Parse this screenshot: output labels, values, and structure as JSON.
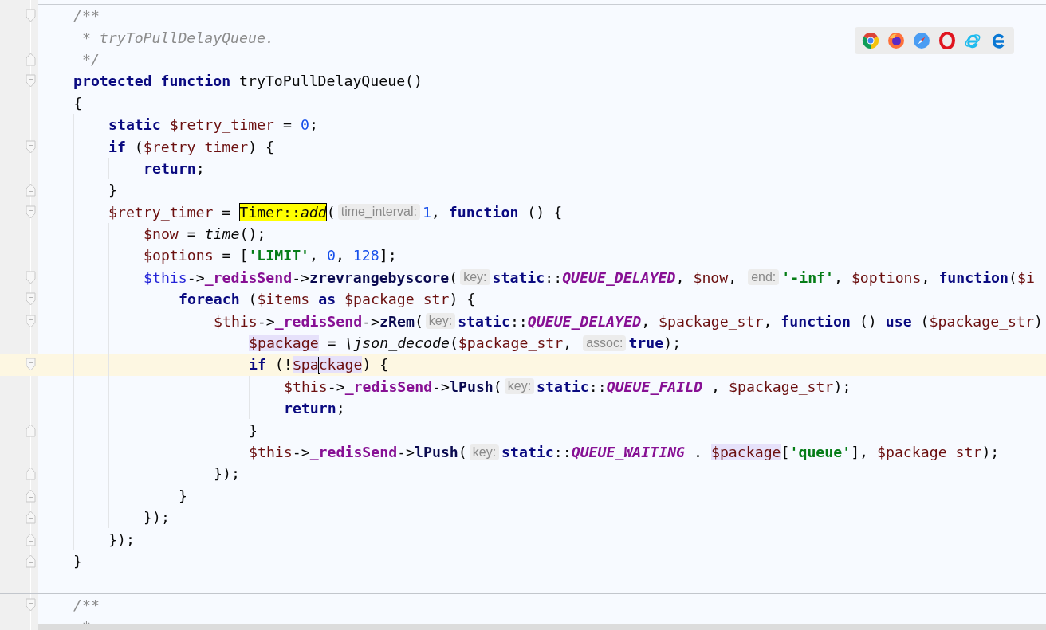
{
  "editor": {
    "lines": [
      {
        "kind": "code",
        "fold_start": true,
        "fold_end": false,
        "selected": false,
        "tokens": [
          {
            "kind": "comment",
            "text": "/**"
          }
        ]
      },
      {
        "kind": "code",
        "fold_start": false,
        "fold_end": false,
        "selected": false,
        "tokens": [
          {
            "kind": "comment",
            "text": " * tryToPullDelayQueue."
          }
        ]
      },
      {
        "kind": "code",
        "fold_start": false,
        "fold_end": true,
        "selected": false,
        "tokens": [
          {
            "kind": "comment",
            "text": " */"
          }
        ]
      },
      {
        "kind": "code",
        "fold_start": true,
        "fold_end": false,
        "selected": false,
        "tokens": [
          {
            "kind": "kw",
            "text": "protected function"
          },
          {
            "kind": "plain",
            "text": " tryToPullDelayQueue()"
          }
        ]
      },
      {
        "kind": "code",
        "fold_start": false,
        "fold_end": false,
        "selected": false,
        "tokens": [
          {
            "kind": "plain",
            "text": "{"
          }
        ],
        "children": [
          {
            "kind": "code",
            "fold_start": false,
            "fold_end": false,
            "selected": false,
            "tokens": [
              {
                "kind": "kw",
                "text": "static "
              },
              {
                "kind": "var",
                "text": "$retry_timer"
              },
              {
                "kind": "plain",
                "text": " = "
              },
              {
                "kind": "num",
                "text": "0"
              },
              {
                "kind": "plain",
                "text": ";"
              }
            ]
          },
          {
            "kind": "code",
            "fold_start": true,
            "fold_end": false,
            "selected": false,
            "tokens": [
              {
                "kind": "kw",
                "text": "if"
              },
              {
                "kind": "plain",
                "text": " ("
              },
              {
                "kind": "var",
                "text": "$retry_timer"
              },
              {
                "kind": "plain",
                "text": ") {"
              }
            ],
            "children": [
              {
                "kind": "code",
                "fold_start": false,
                "fold_end": false,
                "selected": false,
                "tokens": [
                  {
                    "kind": "kw",
                    "text": "return"
                  },
                  {
                    "kind": "plain",
                    "text": ";"
                  }
                ]
              }
            ]
          },
          {
            "kind": "code",
            "fold_start": false,
            "fold_end": true,
            "selected": false,
            "tokens": [
              {
                "kind": "plain",
                "text": "}"
              }
            ]
          },
          {
            "kind": "code",
            "fold_start": true,
            "fold_end": false,
            "selected": false,
            "tokens": [
              {
                "kind": "var",
                "text": "$retry_timer"
              },
              {
                "kind": "plain",
                "text": " = "
              },
              {
                "kind": "hit",
                "text": "Timer::*add*"
              },
              {
                "kind": "plain",
                "text": "("
              },
              {
                "kind": "hint",
                "text": "time_interval:"
              },
              {
                "kind": "num",
                "text": "1"
              },
              {
                "kind": "plain",
                "text": ", "
              },
              {
                "kind": "kw",
                "text": "function"
              },
              {
                "kind": "plain",
                "text": " () {"
              }
            ],
            "children": [
              {
                "kind": "code",
                "fold_start": false,
                "fold_end": false,
                "selected": false,
                "tokens": [
                  {
                    "kind": "var",
                    "text": "$now"
                  },
                  {
                    "kind": "plain",
                    "text": " = "
                  },
                  {
                    "kind": "fn",
                    "text": "time"
                  },
                  {
                    "kind": "plain",
                    "text": "();"
                  }
                ]
              },
              {
                "kind": "code",
                "fold_start": false,
                "fold_end": false,
                "selected": false,
                "tokens": [
                  {
                    "kind": "var",
                    "text": "$options"
                  },
                  {
                    "kind": "plain",
                    "text": " = ["
                  },
                  {
                    "kind": "str",
                    "text": "'LIMIT'"
                  },
                  {
                    "kind": "plain",
                    "text": ", "
                  },
                  {
                    "kind": "num",
                    "text": "0"
                  },
                  {
                    "kind": "plain",
                    "text": ", "
                  },
                  {
                    "kind": "num",
                    "text": "128"
                  },
                  {
                    "kind": "plain",
                    "text": "];"
                  }
                ]
              },
              {
                "kind": "code",
                "fold_start": true,
                "fold_end": false,
                "selected": false,
                "tokens": [
                  {
                    "kind": "link",
                    "text": "$this"
                  },
                  {
                    "kind": "plain",
                    "text": "->"
                  },
                  {
                    "kind": "field",
                    "text": "_redisSend"
                  },
                  {
                    "kind": "plain",
                    "text": "->"
                  },
                  {
                    "kind": "method",
                    "text": "zrevrangebyscore"
                  },
                  {
                    "kind": "plain",
                    "text": "("
                  },
                  {
                    "kind": "hint",
                    "text": "key:"
                  },
                  {
                    "kind": "kw",
                    "text": "static"
                  },
                  {
                    "kind": "plain",
                    "text": "::"
                  },
                  {
                    "kind": "const",
                    "text": "QUEUE_DELAYED"
                  },
                  {
                    "kind": "plain",
                    "text": ", "
                  },
                  {
                    "kind": "var",
                    "text": "$now"
                  },
                  {
                    "kind": "plain",
                    "text": ", "
                  },
                  {
                    "kind": "hint",
                    "text": "end:"
                  },
                  {
                    "kind": "str",
                    "text": "'-inf'"
                  },
                  {
                    "kind": "plain",
                    "text": ", "
                  },
                  {
                    "kind": "var",
                    "text": "$options"
                  },
                  {
                    "kind": "plain",
                    "text": ", "
                  },
                  {
                    "kind": "kw",
                    "text": "function"
                  },
                  {
                    "kind": "plain",
                    "text": "("
                  },
                  {
                    "kind": "var",
                    "text": "$i"
                  }
                ],
                "children": [
                  {
                    "kind": "code",
                    "fold_start": true,
                    "fold_end": false,
                    "selected": false,
                    "tokens": [
                      {
                        "kind": "kw",
                        "text": "foreach"
                      },
                      {
                        "kind": "plain",
                        "text": " ("
                      },
                      {
                        "kind": "var",
                        "text": "$items"
                      },
                      {
                        "kind": "kw",
                        "text": " as "
                      },
                      {
                        "kind": "var",
                        "text": "$package_str"
                      },
                      {
                        "kind": "plain",
                        "text": ") {"
                      }
                    ],
                    "children": [
                      {
                        "kind": "code",
                        "fold_start": true,
                        "fold_end": false,
                        "selected": false,
                        "tokens": [
                          {
                            "kind": "var",
                            "text": "$this"
                          },
                          {
                            "kind": "plain",
                            "text": "->"
                          },
                          {
                            "kind": "field",
                            "text": "_redisSend"
                          },
                          {
                            "kind": "plain",
                            "text": "->"
                          },
                          {
                            "kind": "method",
                            "text": "zRem"
                          },
                          {
                            "kind": "plain",
                            "text": "("
                          },
                          {
                            "kind": "hint",
                            "text": "key:"
                          },
                          {
                            "kind": "kw",
                            "text": "static"
                          },
                          {
                            "kind": "plain",
                            "text": "::"
                          },
                          {
                            "kind": "const",
                            "text": "QUEUE_DELAYED"
                          },
                          {
                            "kind": "plain",
                            "text": ", "
                          },
                          {
                            "kind": "var",
                            "text": "$package_str"
                          },
                          {
                            "kind": "plain",
                            "text": ", "
                          },
                          {
                            "kind": "kw",
                            "text": "function"
                          },
                          {
                            "kind": "plain",
                            "text": " () "
                          },
                          {
                            "kind": "kw",
                            "text": "use"
                          },
                          {
                            "kind": "plain",
                            "text": " ("
                          },
                          {
                            "kind": "var",
                            "text": "$package_str"
                          },
                          {
                            "kind": "plain",
                            "text": ")"
                          }
                        ],
                        "children": [
                          {
                            "kind": "code",
                            "fold_start": false,
                            "fold_end": false,
                            "selected": false,
                            "tokens": [
                              {
                                "kind": "usage",
                                "text": "$package"
                              },
                              {
                                "kind": "plain",
                                "text": " = "
                              },
                              {
                                "kind": "fn",
                                "text": "\\json_decode"
                              },
                              {
                                "kind": "plain",
                                "text": "("
                              },
                              {
                                "kind": "var",
                                "text": "$package_str"
                              },
                              {
                                "kind": "plain",
                                "text": ", "
                              },
                              {
                                "kind": "hint",
                                "text": "assoc:"
                              },
                              {
                                "kind": "kw",
                                "text": "true"
                              },
                              {
                                "kind": "plain",
                                "text": ");"
                              }
                            ]
                          },
                          {
                            "kind": "code",
                            "fold_start": true,
                            "fold_end": false,
                            "selected": true,
                            "tokens": [
                              {
                                "kind": "kw",
                                "text": "if"
                              },
                              {
                                "kind": "plain",
                                "text": " (!"
                              },
                              {
                                "kind": "usage",
                                "text": "$pa"
                              },
                              {
                                "kind": "caret"
                              },
                              {
                                "kind": "usage",
                                "text": "ckage"
                              },
                              {
                                "kind": "plain",
                                "text": ") {"
                              }
                            ],
                            "children": [
                              {
                                "kind": "code",
                                "fold_start": false,
                                "fold_end": false,
                                "selected": false,
                                "tokens": [
                                  {
                                    "kind": "var",
                                    "text": "$this"
                                  },
                                  {
                                    "kind": "plain",
                                    "text": "->"
                                  },
                                  {
                                    "kind": "field",
                                    "text": "_redisSend"
                                  },
                                  {
                                    "kind": "plain",
                                    "text": "->"
                                  },
                                  {
                                    "kind": "method",
                                    "text": "lPush"
                                  },
                                  {
                                    "kind": "plain",
                                    "text": "("
                                  },
                                  {
                                    "kind": "hint",
                                    "text": "key:"
                                  },
                                  {
                                    "kind": "kw",
                                    "text": "static"
                                  },
                                  {
                                    "kind": "plain",
                                    "text": "::"
                                  },
                                  {
                                    "kind": "const",
                                    "text": "QUEUE_FAILD"
                                  },
                                  {
                                    "kind": "plain",
                                    "text": " , "
                                  },
                                  {
                                    "kind": "var",
                                    "text": "$package_str"
                                  },
                                  {
                                    "kind": "plain",
                                    "text": ");"
                                  }
                                ]
                              },
                              {
                                "kind": "code",
                                "fold_start": false,
                                "fold_end": false,
                                "selected": false,
                                "tokens": [
                                  {
                                    "kind": "kw",
                                    "text": "return"
                                  },
                                  {
                                    "kind": "plain",
                                    "text": ";"
                                  }
                                ]
                              }
                            ]
                          },
                          {
                            "kind": "code",
                            "fold_start": false,
                            "fold_end": true,
                            "selected": false,
                            "tokens": [
                              {
                                "kind": "plain",
                                "text": "}"
                              }
                            ]
                          },
                          {
                            "kind": "code",
                            "fold_start": false,
                            "fold_end": false,
                            "selected": false,
                            "tokens": [
                              {
                                "kind": "var",
                                "text": "$this"
                              },
                              {
                                "kind": "plain",
                                "text": "->"
                              },
                              {
                                "kind": "field",
                                "text": "_redisSend"
                              },
                              {
                                "kind": "plain",
                                "text": "->"
                              },
                              {
                                "kind": "method",
                                "text": "lPush"
                              },
                              {
                                "kind": "plain",
                                "text": "("
                              },
                              {
                                "kind": "hint",
                                "text": "key:"
                              },
                              {
                                "kind": "kw",
                                "text": "static"
                              },
                              {
                                "kind": "plain",
                                "text": "::"
                              },
                              {
                                "kind": "const",
                                "text": "QUEUE_WAITING"
                              },
                              {
                                "kind": "plain",
                                "text": " . "
                              },
                              {
                                "kind": "usage",
                                "text": "$package"
                              },
                              {
                                "kind": "plain",
                                "text": "["
                              },
                              {
                                "kind": "str",
                                "text": "'queue'"
                              },
                              {
                                "kind": "plain",
                                "text": "], "
                              },
                              {
                                "kind": "var",
                                "text": "$package_str"
                              },
                              {
                                "kind": "plain",
                                "text": ");"
                              }
                            ]
                          }
                        ]
                      },
                      {
                        "kind": "code",
                        "fold_start": false,
                        "fold_end": true,
                        "selected": false,
                        "tokens": [
                          {
                            "kind": "plain",
                            "text": "});"
                          }
                        ]
                      }
                    ]
                  },
                  {
                    "kind": "code",
                    "fold_start": false,
                    "fold_end": true,
                    "selected": false,
                    "tokens": [
                      {
                        "kind": "plain",
                        "text": "}"
                      }
                    ]
                  }
                ]
              },
              {
                "kind": "code",
                "fold_start": false,
                "fold_end": true,
                "selected": false,
                "tokens": [
                  {
                    "kind": "plain",
                    "text": "});"
                  }
                ]
              }
            ]
          },
          {
            "kind": "code",
            "fold_start": false,
            "fold_end": true,
            "selected": false,
            "tokens": [
              {
                "kind": "plain",
                "text": "});"
              }
            ]
          }
        ]
      },
      {
        "kind": "code",
        "fold_start": false,
        "fold_end": true,
        "selected": false,
        "tokens": [
          {
            "kind": "plain",
            "text": "}"
          }
        ]
      },
      {
        "kind": "separator",
        "fold_start": false,
        "fold_end": false,
        "selected": false
      },
      {
        "kind": "code",
        "fold_start": true,
        "fold_end": false,
        "selected": false,
        "tokens": [
          {
            "kind": "comment",
            "text": "/**"
          }
        ]
      },
      {
        "kind": "code",
        "fold_start": false,
        "fold_end": false,
        "selected": false,
        "tokens": [
          {
            "kind": "comment",
            "text": " *"
          }
        ]
      }
    ]
  },
  "browser_icons": [
    {
      "kind": "chrome"
    },
    {
      "kind": "firefox"
    },
    {
      "kind": "safari"
    },
    {
      "kind": "opera"
    },
    {
      "kind": "ie"
    },
    {
      "kind": "edge"
    }
  ]
}
